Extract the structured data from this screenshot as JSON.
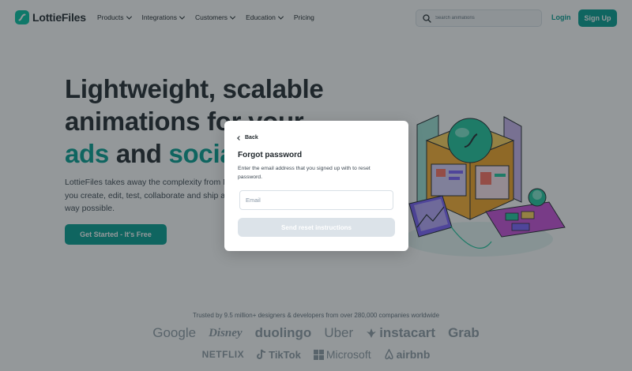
{
  "header": {
    "logo_text": "LottieFiles",
    "nav": [
      {
        "label": "Products",
        "has_dropdown": true
      },
      {
        "label": "Integrations",
        "has_dropdown": true
      },
      {
        "label": "Customers",
        "has_dropdown": true
      },
      {
        "label": "Education",
        "has_dropdown": true
      },
      {
        "label": "Pricing",
        "has_dropdown": false
      }
    ],
    "search_placeholder": "Search animations",
    "login_label": "Login",
    "signup_label": "Sign Up"
  },
  "hero": {
    "title_line1": "Lightweight, scalable",
    "title_line2": "animations for your",
    "title_line3_accent_a": "ads",
    "title_line3_mid": " and ",
    "title_line3_accent_b": "social",
    "description": "LottieFiles takes away the complexity from Motion Design. It lets you create, edit, test, collaborate and ship a Lottie in the easiest way possible.",
    "cta_label": "Get Started - It's Free"
  },
  "trusted": {
    "text": "Trusted by 9.5 million+ designers & developers from over 280,000 companies worldwide",
    "brands_row1": [
      "Google",
      "Disney",
      "duolingo",
      "Uber",
      "instacart",
      "Grab"
    ],
    "brands_row2": [
      "NETFLIX",
      "TikTok",
      "Microsoft",
      "airbnb"
    ]
  },
  "modal": {
    "back_label": "Back",
    "title": "Forgot password",
    "description": "Enter the email address that you signed up with to reset password.",
    "email_placeholder": "Email",
    "send_label": "Send reset instructions"
  },
  "colors": {
    "brand": "#019d91",
    "text": "#20272c",
    "overlay": "rgba(32,39,44,0.48)",
    "disabled_button": "#dce3e9"
  },
  "icons": [
    "lottie-logo-icon",
    "chevron-down-icon",
    "search-icon",
    "chevron-left-icon",
    "microsoft-logo-icon",
    "tiktok-logo-icon",
    "airbnb-logo-icon"
  ]
}
